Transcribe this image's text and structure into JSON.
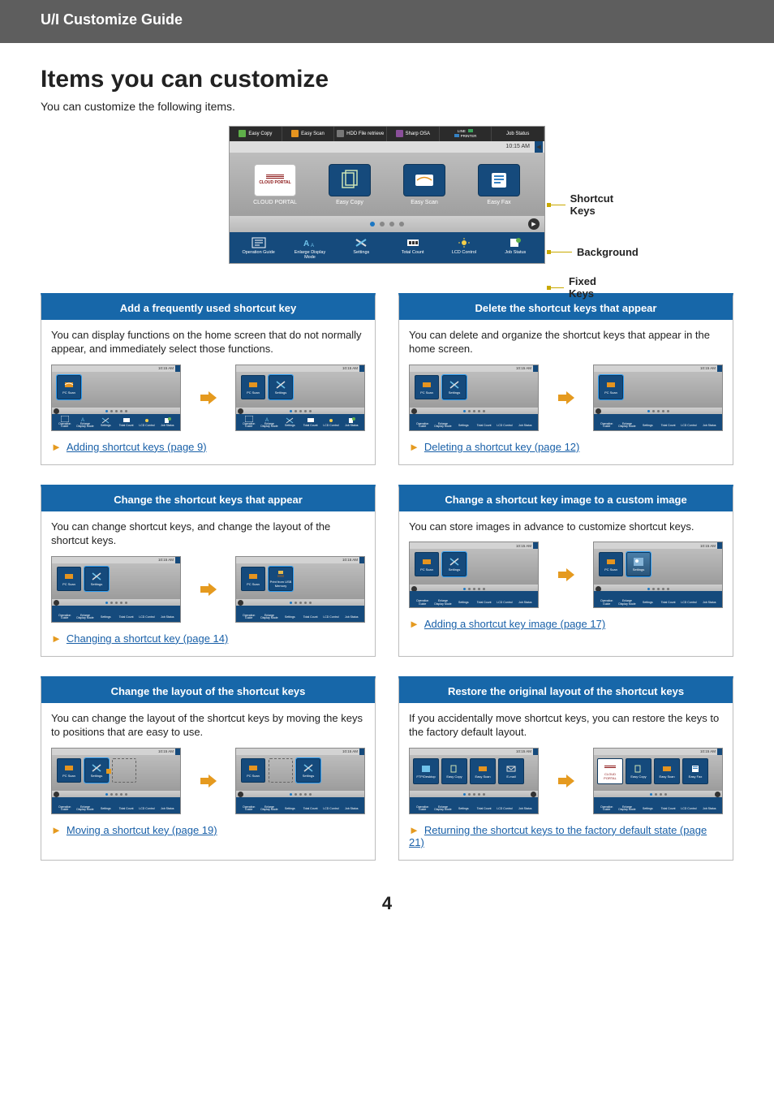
{
  "header": {
    "title": "U/I Customize Guide"
  },
  "page": {
    "heading": "Items you can customize",
    "intro": "You can customize the following items.",
    "number": "4"
  },
  "main_screenshot": {
    "tabs": [
      "Easy Copy",
      "Easy Scan",
      "HDD File retrieve",
      "Sharp OSA",
      "",
      "Job Status"
    ],
    "status_indicators": {
      "line": "LINE",
      "printer": "PRINTER"
    },
    "clock": "10:15 AM",
    "big_icons": [
      {
        "label": "CLOUD PORTAL",
        "icon": "cloud",
        "logo_text": "CLOUD PORTAL"
      },
      {
        "label": "Easy Copy",
        "icon": "copy"
      },
      {
        "label": "Easy Scan",
        "icon": "scan"
      },
      {
        "label": "Easy Fax",
        "icon": "fax"
      }
    ],
    "bottom_icons": [
      {
        "label": "Operation Guide",
        "icon": "guide"
      },
      {
        "label": "Enlarge Display Mode",
        "icon": "enlarge"
      },
      {
        "label": "Settings",
        "icon": "settings"
      },
      {
        "label": "Total Count",
        "icon": "count"
      },
      {
        "label": "LCD Control",
        "icon": "lcd"
      },
      {
        "label": "Job Status",
        "icon": "job"
      }
    ]
  },
  "callouts": {
    "shortcut": "Shortcut Keys",
    "background": "Background",
    "fixed": "Fixed Keys"
  },
  "mini_common": {
    "clock": "10:15 AM",
    "tiles": {
      "pc_scan": "PC Scan",
      "settings": "Settings",
      "print_usb": "Print from USB Memory",
      "ftp": "FTP/Desktop",
      "easy_copy": "Easy Copy",
      "easy_scan": "Easy Scan",
      "email": "E-mail",
      "cloud": "CLOUD PORTAL",
      "easy_fax": "Easy Fax"
    },
    "bottom": [
      "Operation Guide",
      "Enlarge Display Mode",
      "Settings",
      "Total Count",
      "LCD Control",
      "Job Status"
    ]
  },
  "cards": [
    {
      "title": "Add a frequently used shortcut key",
      "desc": "You can display functions on the home screen that do not normally appear, and immediately select those functions.",
      "link": "Adding shortcut keys (page 9)"
    },
    {
      "title": "Delete the shortcut keys that appear",
      "desc": "You can delete and organize the shortcut keys that appear in the home screen.",
      "link": "Deleting a shortcut key (page 12)"
    },
    {
      "title": "Change the shortcut keys that appear",
      "desc": "You can change shortcut keys, and change the layout of the shortcut keys.",
      "link": "Changing a shortcut key (page 14)"
    },
    {
      "title": "Change a shortcut key image to a custom image",
      "desc": "You can store images in advance to customize shortcut keys.",
      "link": "Adding a shortcut key image (page 17)"
    },
    {
      "title": "Change the layout of the shortcut keys",
      "desc": "You can change the layout of the shortcut keys by moving the keys to positions that are easy to use.",
      "link": "Moving a shortcut key (page 19)"
    },
    {
      "title": "Restore the original layout of the shortcut keys",
      "desc": "If you accidentally move shortcut keys, you can restore the keys to the factory default layout.",
      "link": "Returning the shortcut keys to the factory default state (page 21)"
    }
  ]
}
